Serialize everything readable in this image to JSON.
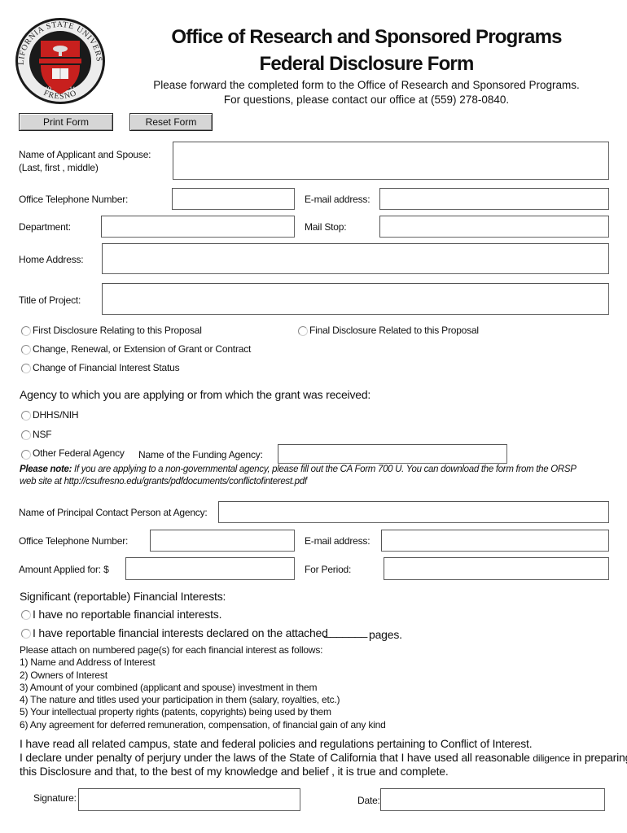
{
  "header": {
    "logo": {
      "top_text": "CALIFORNIA STATE UNIVERSITY",
      "bottom_text": "FRESNO",
      "year_left": "19",
      "year_right": "11",
      "colors": {
        "shield": "#c8201e",
        "ring": "#1a1a1a",
        "outer": "#e8e8e8"
      }
    },
    "title_line1": "Office of Research and Sponsored Programs",
    "title_line2": "Federal Disclosure Form",
    "instruction_line1": "Please forward the completed form to the Office of Research and Sponsored Programs.",
    "instruction_line2": "For questions, please contact our office at (559) 278-0840."
  },
  "buttons": {
    "print": "Print Form",
    "reset": "Reset Form"
  },
  "applicant": {
    "name_label_line1": "Name of Applicant and Spouse:",
    "name_label_line2": "(Last, first , middle)",
    "name_value": "",
    "phone_label": "Office Telephone Number:",
    "phone_value": "",
    "email_label": "E-mail address:",
    "email_value": "",
    "department_label": "Department:",
    "department_value": "",
    "mailstop_label": "Mail Stop:",
    "mailstop_value": "",
    "home_address_label": "Home Address:",
    "home_address_value": "",
    "project_title_label": "Title of Project:",
    "project_title_value": ""
  },
  "disclosure_type": {
    "options": [
      {
        "label": "First Disclosure Relating to this Proposal",
        "selected": false
      },
      {
        "label": "Final Disclosure Related to this Proposal",
        "selected": false
      },
      {
        "label": "Change, Renewal, or Extension of Grant or Contract",
        "selected": false
      },
      {
        "label": "Change of Financial Interest Status",
        "selected": false
      }
    ]
  },
  "agency": {
    "heading": "Agency to which you are applying  or from which the grant was received:",
    "options": [
      {
        "label": "DHHS/NIH",
        "selected": false
      },
      {
        "label": "NSF",
        "selected": false
      },
      {
        "label": "Other Federal Agency",
        "selected": false
      }
    ],
    "funding_agency_label": "Name of the Funding Agency:",
    "funding_agency_value": "",
    "note_bold": "Please note:",
    "note_text_line1": " If you are applying to a non-governmental agency, please fill out the CA Form 700 U. You can download the form from the ORSP",
    "note_text_line2": "web site at  http://csufresno.edu/grants/pdfdocuments/conflictofinterest.pdf"
  },
  "contact": {
    "principal_label": "Name of Principal Contact Person at Agency:",
    "principal_value": "",
    "phone_label": "Office Telephone Number:",
    "phone_value": "",
    "email_label": "E-mail address:",
    "email_value": "",
    "amount_label": "Amount Applied for: $",
    "amount_value": "",
    "period_label": "For Period:",
    "period_value": ""
  },
  "financial": {
    "heading": "Significant (reportable) Financial Interests:",
    "option_none": "I have no reportable financial interests.",
    "option_some": "I have reportable financial interests declared on the attached",
    "pages_blank": "_______",
    "pages_suffix": "pages.",
    "attach_intro": "Please attach on numbered page(s) for each financial interest as follows:",
    "items": [
      "1) Name and Address of Interest",
      "2) Owners of Interest",
      "3) Amount of your combined (applicant and spouse) investment in them",
      "4) The nature and titles used your participation in them (salary, royalties, etc.)",
      "5) Your intellectual property rights (patents, copyrights) being used by them",
      "6) Any agreement for deferred remuneration, compensation, of financial gain of any kind"
    ]
  },
  "declaration": {
    "line1": "I have read all related campus, state and federal policies and regulations pertaining to Conflict of Interest.",
    "line2a": "I declare under penalty of perjury under the laws of the State of California that I have used all reasonable ",
    "line2b": "diligence",
    "line2c": " in preparing",
    "line3": "this Disclosure and that, to the best of my knowledge and belief , it is true and complete."
  },
  "signature": {
    "signature_label": "Signature:",
    "signature_value": "",
    "date_label": "Date:",
    "date_value": ""
  }
}
